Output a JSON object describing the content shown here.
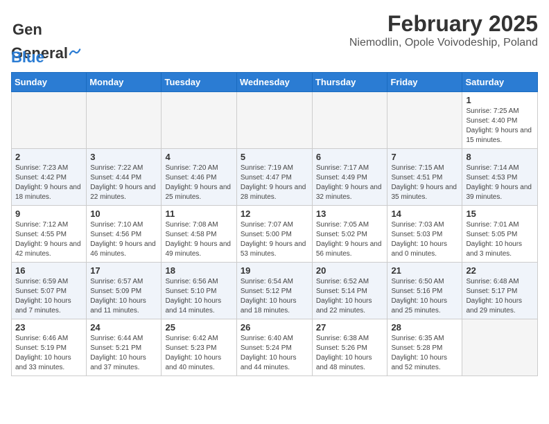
{
  "header": {
    "logo_general": "General",
    "logo_blue": "Blue",
    "title": "February 2025",
    "subtitle": "Niemodlin, Opole Voivodeship, Poland"
  },
  "weekdays": [
    "Sunday",
    "Monday",
    "Tuesday",
    "Wednesday",
    "Thursday",
    "Friday",
    "Saturday"
  ],
  "weeks": [
    [
      {
        "day": "",
        "info": ""
      },
      {
        "day": "",
        "info": ""
      },
      {
        "day": "",
        "info": ""
      },
      {
        "day": "",
        "info": ""
      },
      {
        "day": "",
        "info": ""
      },
      {
        "day": "",
        "info": ""
      },
      {
        "day": "1",
        "info": "Sunrise: 7:25 AM\nSunset: 4:40 PM\nDaylight: 9 hours and 15 minutes."
      }
    ],
    [
      {
        "day": "2",
        "info": "Sunrise: 7:23 AM\nSunset: 4:42 PM\nDaylight: 9 hours and 18 minutes."
      },
      {
        "day": "3",
        "info": "Sunrise: 7:22 AM\nSunset: 4:44 PM\nDaylight: 9 hours and 22 minutes."
      },
      {
        "day": "4",
        "info": "Sunrise: 7:20 AM\nSunset: 4:46 PM\nDaylight: 9 hours and 25 minutes."
      },
      {
        "day": "5",
        "info": "Sunrise: 7:19 AM\nSunset: 4:47 PM\nDaylight: 9 hours and 28 minutes."
      },
      {
        "day": "6",
        "info": "Sunrise: 7:17 AM\nSunset: 4:49 PM\nDaylight: 9 hours and 32 minutes."
      },
      {
        "day": "7",
        "info": "Sunrise: 7:15 AM\nSunset: 4:51 PM\nDaylight: 9 hours and 35 minutes."
      },
      {
        "day": "8",
        "info": "Sunrise: 7:14 AM\nSunset: 4:53 PM\nDaylight: 9 hours and 39 minutes."
      }
    ],
    [
      {
        "day": "9",
        "info": "Sunrise: 7:12 AM\nSunset: 4:55 PM\nDaylight: 9 hours and 42 minutes."
      },
      {
        "day": "10",
        "info": "Sunrise: 7:10 AM\nSunset: 4:56 PM\nDaylight: 9 hours and 46 minutes."
      },
      {
        "day": "11",
        "info": "Sunrise: 7:08 AM\nSunset: 4:58 PM\nDaylight: 9 hours and 49 minutes."
      },
      {
        "day": "12",
        "info": "Sunrise: 7:07 AM\nSunset: 5:00 PM\nDaylight: 9 hours and 53 minutes."
      },
      {
        "day": "13",
        "info": "Sunrise: 7:05 AM\nSunset: 5:02 PM\nDaylight: 9 hours and 56 minutes."
      },
      {
        "day": "14",
        "info": "Sunrise: 7:03 AM\nSunset: 5:03 PM\nDaylight: 10 hours and 0 minutes."
      },
      {
        "day": "15",
        "info": "Sunrise: 7:01 AM\nSunset: 5:05 PM\nDaylight: 10 hours and 3 minutes."
      }
    ],
    [
      {
        "day": "16",
        "info": "Sunrise: 6:59 AM\nSunset: 5:07 PM\nDaylight: 10 hours and 7 minutes."
      },
      {
        "day": "17",
        "info": "Sunrise: 6:57 AM\nSunset: 5:09 PM\nDaylight: 10 hours and 11 minutes."
      },
      {
        "day": "18",
        "info": "Sunrise: 6:56 AM\nSunset: 5:10 PM\nDaylight: 10 hours and 14 minutes."
      },
      {
        "day": "19",
        "info": "Sunrise: 6:54 AM\nSunset: 5:12 PM\nDaylight: 10 hours and 18 minutes."
      },
      {
        "day": "20",
        "info": "Sunrise: 6:52 AM\nSunset: 5:14 PM\nDaylight: 10 hours and 22 minutes."
      },
      {
        "day": "21",
        "info": "Sunrise: 6:50 AM\nSunset: 5:16 PM\nDaylight: 10 hours and 25 minutes."
      },
      {
        "day": "22",
        "info": "Sunrise: 6:48 AM\nSunset: 5:17 PM\nDaylight: 10 hours and 29 minutes."
      }
    ],
    [
      {
        "day": "23",
        "info": "Sunrise: 6:46 AM\nSunset: 5:19 PM\nDaylight: 10 hours and 33 minutes."
      },
      {
        "day": "24",
        "info": "Sunrise: 6:44 AM\nSunset: 5:21 PM\nDaylight: 10 hours and 37 minutes."
      },
      {
        "day": "25",
        "info": "Sunrise: 6:42 AM\nSunset: 5:23 PM\nDaylight: 10 hours and 40 minutes."
      },
      {
        "day": "26",
        "info": "Sunrise: 6:40 AM\nSunset: 5:24 PM\nDaylight: 10 hours and 44 minutes."
      },
      {
        "day": "27",
        "info": "Sunrise: 6:38 AM\nSunset: 5:26 PM\nDaylight: 10 hours and 48 minutes."
      },
      {
        "day": "28",
        "info": "Sunrise: 6:35 AM\nSunset: 5:28 PM\nDaylight: 10 hours and 52 minutes."
      },
      {
        "day": "",
        "info": ""
      }
    ]
  ]
}
